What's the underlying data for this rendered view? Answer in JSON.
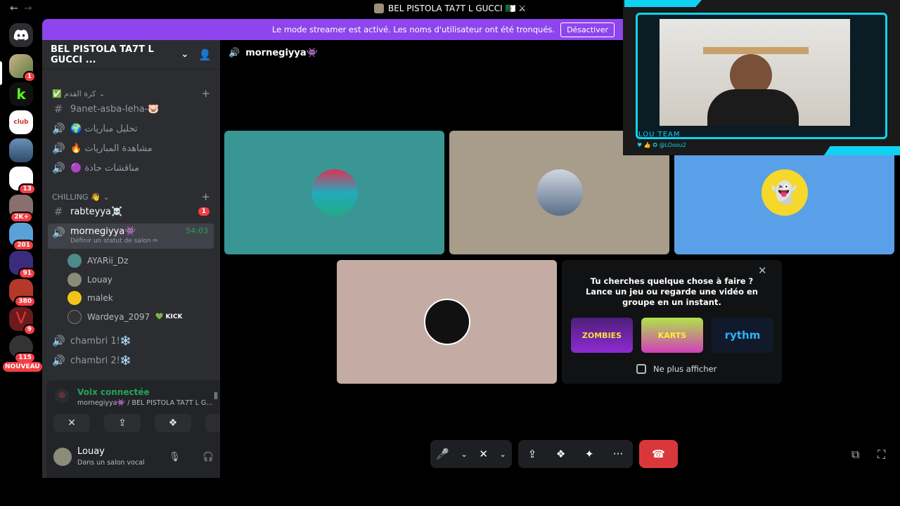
{
  "window": {
    "title": "BEL PISTOLA TA7T L GUCCI 🇩🇿 ⚔",
    "back": "←",
    "forward": "→"
  },
  "banner": {
    "text": "Le mode streamer est activé. Les noms d'utilisateur ont été tronqués.",
    "button": "Désactiver"
  },
  "rail": {
    "badges": [
      "1",
      "13",
      "2K+",
      "201",
      "91",
      "380",
      "9",
      "115"
    ],
    "new_label": "NOUVEAU",
    "colors": [
      "#7c8a53",
      "#1b1b1b",
      "#ffffff",
      "#4a5d80",
      "#ffffff",
      "#8a6f6f",
      "#5aa1d8",
      "#3a2c7a",
      "#b33a2a",
      "#6b1b1b",
      "#333"
    ]
  },
  "server": {
    "name": "BEL PISTOLA TA7T L GUCCI ...",
    "categories": [
      {
        "label": "✅ كرة القدم"
      },
      {
        "label": "CHILLING 👋"
      }
    ],
    "channels": [
      {
        "icon": "#",
        "name": "9anet-asba-leha-🐷"
      },
      {
        "icon": "🔊",
        "name": "🌍 تحليل مباريات"
      },
      {
        "icon": "🔊",
        "name": "🔥 مشاهدة المباريات"
      },
      {
        "icon": "🔊",
        "name": "🟣 مناقشات حادة"
      },
      {
        "icon": "#",
        "name": "rabteyya☠️",
        "badge": "1"
      },
      {
        "icon": "🔊",
        "name": "mornegiyya👾",
        "time": "54:03",
        "status": "Définir un statut de salon ✏"
      },
      {
        "icon": "🔊",
        "name": "chambri 1!❄️"
      },
      {
        "icon": "🔊",
        "name": "chambri 2!❄️"
      }
    ],
    "voice_users": [
      {
        "name": "AYARii_Dz",
        "color": "#4f8a8b"
      },
      {
        "name": "Louay",
        "color": "#8b8b7a"
      },
      {
        "name": "malek",
        "color": "#f0c419"
      },
      {
        "name": "Wardeya_2097",
        "tag": "💚 KICK",
        "color": "#333"
      }
    ]
  },
  "voice_panel": {
    "status": "Voix connectée",
    "location": "mornegiyya👾 / BEL PISTOLA TA7T L G...",
    "buttons": [
      "✕",
      "⇪",
      "❖",
      "✦"
    ]
  },
  "user_panel": {
    "name": "Louay",
    "sub": "Dans un salon vocal"
  },
  "main": {
    "channel_title": "mornegiyya👾",
    "tiles": [
      {
        "color": "#3a9595"
      },
      {
        "color": "#a89c8a"
      },
      {
        "color": "#5aa0e8"
      },
      {
        "color": "#c4aca4"
      }
    ],
    "promo": {
      "line1": "Tu cherches quelque chose à faire ?",
      "line2": "Lance un jeu ou regarde une vidéo en groupe en un instant.",
      "games": [
        "ZOMBIES",
        "KARTS",
        "rythm"
      ],
      "checkbox": "Ne plus afficher",
      "close": "✕"
    },
    "controls": [
      "🎤",
      "⌄",
      "✕",
      "⌄",
      "⇪",
      "❖",
      "✦",
      "···",
      "☎"
    ]
  },
  "overlay": {
    "team": "LOU TEAM",
    "handle": "@LOoou2"
  }
}
